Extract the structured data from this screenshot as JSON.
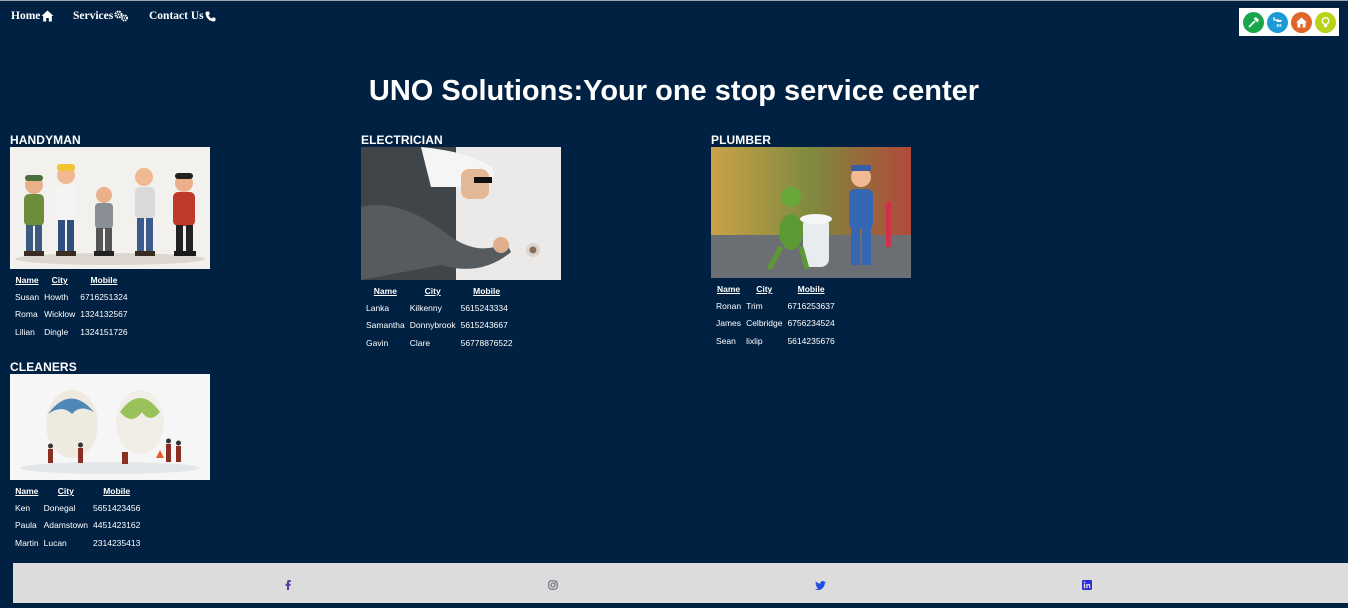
{
  "nav": {
    "home": "Home",
    "services": "Services",
    "contact": "Contact Us"
  },
  "header": {
    "title": "UNO Solutions:Your one stop service center"
  },
  "table_headers": {
    "name": "Name",
    "city": "City",
    "mobile": "Mobile"
  },
  "sections": {
    "handyman": {
      "title": "HANDYMAN",
      "rows": [
        {
          "name": "Susan",
          "city": "Howth",
          "mobile": "6716251324"
        },
        {
          "name": "Roma",
          "city": "Wicklow",
          "mobile": "1324132567"
        },
        {
          "name": "Lilian",
          "city": "Dingle",
          "mobile": "1324151726"
        }
      ]
    },
    "electrician": {
      "title": "ELECTRICIAN",
      "rows": [
        {
          "name": "Lanka",
          "city": "Kilkenny",
          "mobile": "5615243334"
        },
        {
          "name": "Samantha",
          "city": "Donnybrook",
          "mobile": "5615243667"
        },
        {
          "name": "Gavin",
          "city": "Clare",
          "mobile": "56778876522"
        }
      ]
    },
    "plumber": {
      "title": "PLUMBER",
      "rows": [
        {
          "name": "Ronan",
          "city": "Trim",
          "mobile": "6716253637"
        },
        {
          "name": "James",
          "city": "Celbridge",
          "mobile": "6756234524"
        },
        {
          "name": "Sean",
          "city": "lixlip",
          "mobile": "5614235676"
        }
      ]
    },
    "cleaners": {
      "title": "CLEANERS",
      "rows": [
        {
          "name": "Ken",
          "city": "Donegal",
          "mobile": "5651423456"
        },
        {
          "name": "Paula",
          "city": "Adamstown",
          "mobile": "4451423162"
        },
        {
          "name": "Martin",
          "city": "Lucan",
          "mobile": "2314235413"
        }
      ]
    }
  },
  "footer": {
    "icons": [
      "facebook-icon",
      "instagram-icon",
      "twitter-icon",
      "linkedin-icon"
    ]
  },
  "colors": {
    "background": "#002142",
    "footer": "#dcdcdc",
    "facebook": "#5b3a9e",
    "twitter": "#1d4fe0",
    "linkedin": "#2b2bd6"
  }
}
